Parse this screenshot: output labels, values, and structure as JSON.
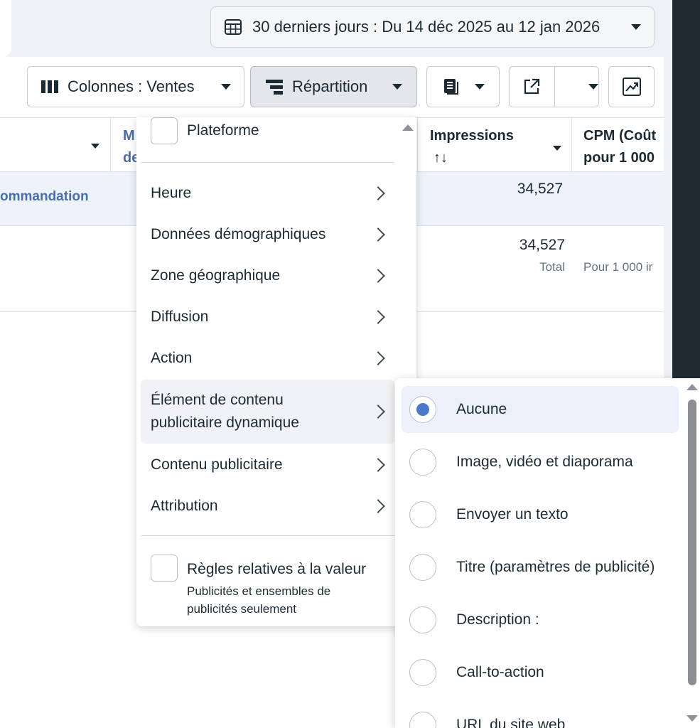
{
  "date_range": {
    "label": "30 derniers jours : Du 14 déc 2025 au 12 jan 2026"
  },
  "toolbar": {
    "columns_label": "Colonnes : Ventes",
    "breakdown_label": "Répartition"
  },
  "table": {
    "headers": {
      "partial_col": "M\nde",
      "impressions": "Impressions",
      "sort_arrows": "↑↓",
      "cpm_line1": "CPM (Coût",
      "cpm_line2": "pour 1 000"
    },
    "row1": {
      "name_partial": "ommandation",
      "impressions": "34,527"
    },
    "totals": {
      "impressions": "34,527",
      "impressions_sub": "Total",
      "cpm_sub": "Pour 1 000 ir"
    }
  },
  "breakdown_menu": {
    "top_checkbox": "Plateforme",
    "items": [
      "Heure",
      "Données démographiques",
      "Zone géographique",
      "Diffusion",
      "Action",
      "Élément de contenu publicitaire dynamique",
      "Contenu publicitaire",
      "Attribution"
    ],
    "highlighted_line1": "Élément de contenu",
    "highlighted_line2": "publicitaire dynamique",
    "value_rules": {
      "title": "Règles relatives à la valeur",
      "subtitle_line1": "Publicités et ensembles de",
      "subtitle_line2": "publicités seulement"
    }
  },
  "submenu": {
    "options": [
      {
        "label": "Aucune",
        "selected": true
      },
      {
        "label": "Image, vidéo et diaporama",
        "selected": false
      },
      {
        "label": "Envoyer un texto",
        "selected": false
      },
      {
        "label": "Titre (paramètres de publicité)",
        "selected": false
      },
      {
        "label": "Description :",
        "selected": false
      },
      {
        "label": "Call-to-action",
        "selected": false
      },
      {
        "label": "URL du site web",
        "selected": false
      }
    ]
  },
  "colors": {
    "accent": "#4a79c9",
    "link": "#4a6ea8",
    "selected_bg": "#ebf0fb"
  }
}
